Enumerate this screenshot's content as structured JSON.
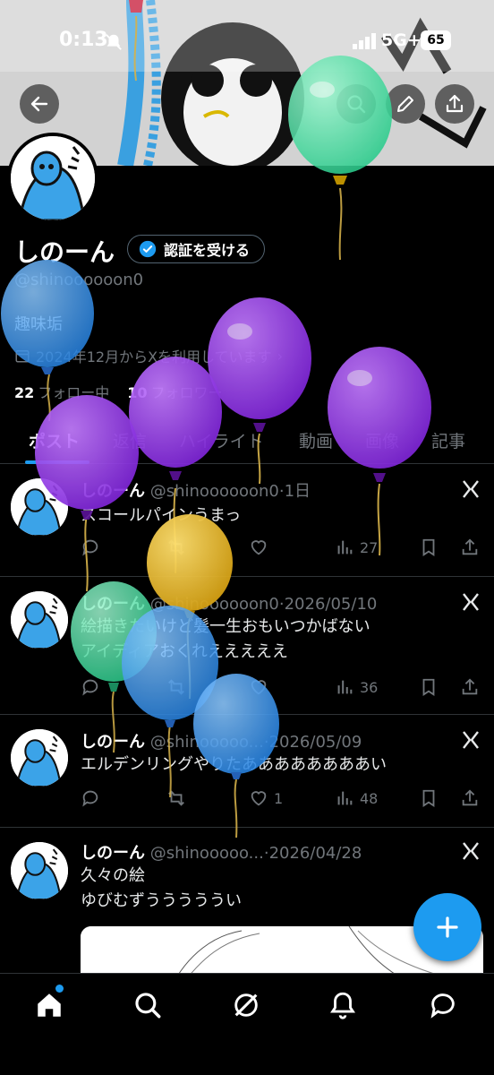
{
  "status_bar": {
    "time": "0:13",
    "network": "5G+",
    "battery": "65"
  },
  "header": {
    "back_icon": "arrow-left-icon",
    "search_icon": "search-icon",
    "edit_icon": "pencil-icon",
    "share_icon": "share-icon"
  },
  "profile": {
    "display_name": "しのーん",
    "verify_label": "認証を受ける",
    "handle": "@shinoooooon0",
    "bio": "趣味垢",
    "joined": "2024年12月からXを利用しています",
    "following_count": "22",
    "following_label": "フォロー中",
    "followers_count": "10",
    "followers_label": "フォロワー"
  },
  "tabs": [
    "ポスト",
    "返信",
    "ハイライト",
    "動画",
    "画像",
    "記事"
  ],
  "posts": [
    {
      "name": "しのーん",
      "handle": "@shinoooooon0",
      "date": "·1日",
      "lines": [
        "スコールパインうまっ"
      ],
      "replies": "",
      "reposts": "",
      "likes": "",
      "views": "27"
    },
    {
      "name": "しのーん",
      "handle": "@shinoooooon0",
      "date": "·2026/05/10",
      "lines": [
        "絵描きたいけど髪一生おもいつかばない",
        "アイディアおくれえええええ"
      ],
      "replies": "",
      "reposts": "",
      "likes": "",
      "views": "36"
    },
    {
      "name": "しのーん",
      "handle": "@shinooooo...",
      "date": "·2026/05/09",
      "lines": [
        "エルデンリングやりたああああああああい"
      ],
      "replies": "",
      "reposts": "",
      "likes": "1",
      "views": "48"
    },
    {
      "name": "しのーん",
      "handle": "@shinooooo...",
      "date": "·2026/04/28",
      "lines": [
        "久々の絵",
        "ゆびむずうううううい"
      ]
    }
  ],
  "colors": {
    "accent": "#1d9bf0",
    "background": "#000000",
    "muted": "#71767b",
    "balloon_green": "#3ddc97",
    "balloon_purple": "#8a2be2",
    "balloon_blue": "#2f8ff0",
    "balloon_gold": "#e0b21c"
  },
  "nav": [
    "home-icon",
    "search-icon",
    "grok-icon",
    "bell-icon",
    "messages-icon"
  ]
}
